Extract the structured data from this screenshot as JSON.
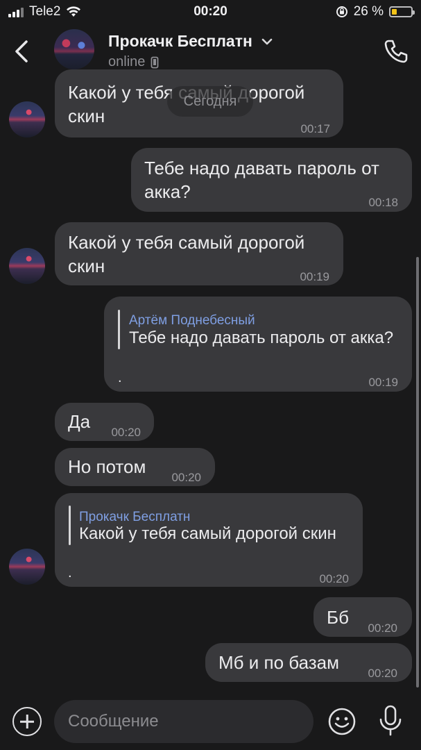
{
  "status_bar": {
    "carrier": "Tele2",
    "time": "00:20",
    "battery_percent": "26 %",
    "battery_level": 0.26
  },
  "header": {
    "contact_name": "Прокачк Бесплатн",
    "status": "online",
    "icons": [
      "back-chevron-icon",
      "chevron-down-icon",
      "mobile-device-icon",
      "phone-icon"
    ]
  },
  "date_divider": "Сегодня",
  "messages": [
    {
      "side": "in",
      "text_line1": "Какой у тебя самый дорогой",
      "text_line2": "скин",
      "time": "00:17"
    },
    {
      "side": "out",
      "text_line1": "Тебе надо давать пароль от",
      "text_line2": "акка?",
      "time": "00:18"
    },
    {
      "side": "in",
      "text_line1": "Какой у тебя самый дорогой",
      "text_line2": "скин",
      "time": "00:19"
    },
    {
      "side": "out",
      "reply_author": "Артём Поднебесный",
      "reply_text": "Тебе надо давать пароль от акка?",
      "text": ".",
      "time": "00:19"
    },
    {
      "side": "in",
      "text": "Да",
      "time": "00:20"
    },
    {
      "side": "in",
      "text": "Но потом",
      "time": "00:20"
    },
    {
      "side": "in",
      "reply_author": "Прокачк Бесплатн",
      "reply_text": "Какой у тебя самый дорогой скин",
      "text": ".",
      "time": "00:20"
    },
    {
      "side": "out",
      "text": "Бб",
      "time": "00:20"
    },
    {
      "side": "out",
      "text": "Мб и по базам",
      "time": "00:20"
    }
  ],
  "composer": {
    "placeholder": "Сообщение",
    "icons": [
      "plus-icon",
      "emoji-icon",
      "microphone-icon"
    ]
  },
  "colors": {
    "background": "#19191a",
    "bubble": "#39393c",
    "reply_name": "#7f9fe3",
    "battery_fill": "#f2c318"
  }
}
